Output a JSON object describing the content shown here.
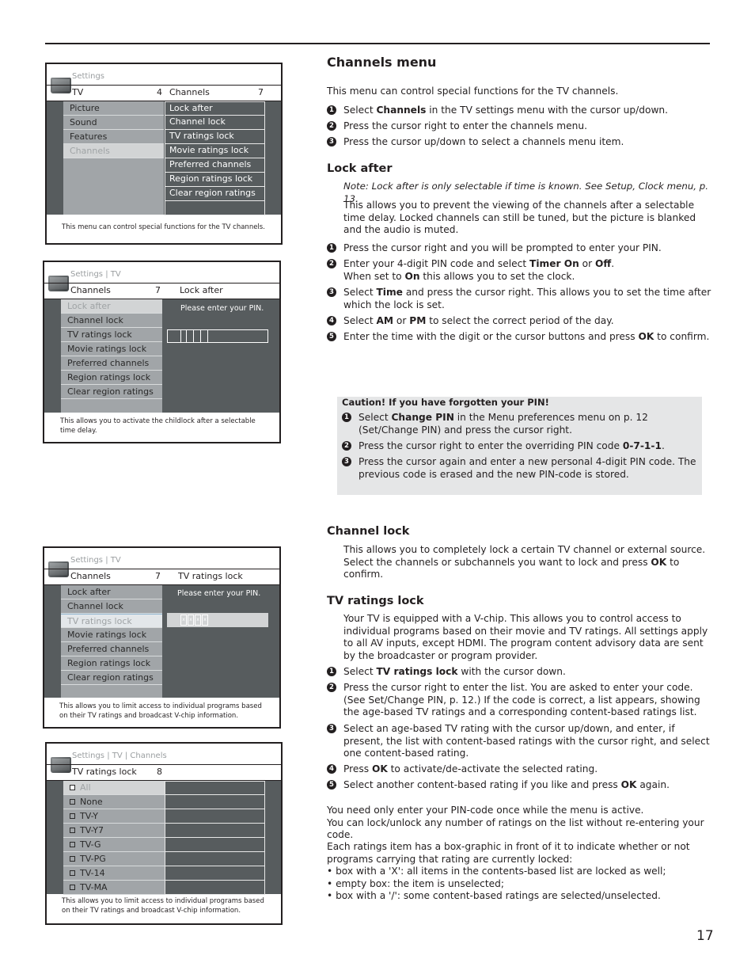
{
  "page_number": "17",
  "screens": {
    "channels_menu": {
      "breadcrumb": "Settings",
      "left_title": "TV",
      "left_count": "4",
      "right_title": "Channels",
      "right_count": "7",
      "left_items": [
        "Picture",
        "Sound",
        "Features",
        "Channels"
      ],
      "selected_left": "Channels",
      "right_items": [
        "Lock after",
        "Channel lock",
        "TV ratings lock",
        "Movie ratings lock",
        "Preferred channels",
        "Region ratings lock",
        "Clear region ratings"
      ],
      "footer": "This menu can control special functions for the TV channels."
    },
    "lock_after": {
      "breadcrumb": "Settings | TV",
      "left_title": "Channels",
      "left_count": "7",
      "right_title": "Lock after",
      "left_items": [
        "Lock after",
        "Channel lock",
        "TV ratings lock",
        "Movie ratings lock",
        "Preferred channels",
        "Region ratings lock",
        "Clear region ratings"
      ],
      "selected_left": "Lock after",
      "pin_prompt": "Please enter your PIN.",
      "footer": "This allows you to activate the childlock after a selectable time delay."
    },
    "tv_ratings_pin": {
      "breadcrumb": "Settings | TV",
      "left_title": "Channels",
      "left_count": "7",
      "right_title": "TV ratings lock",
      "left_items": [
        "Lock after",
        "Channel lock",
        "TV ratings lock",
        "Movie ratings lock",
        "Preferred channels",
        "Region ratings lock",
        "Clear region ratings"
      ],
      "selected_left": "TV ratings lock",
      "pin_prompt": "Please enter your PIN.",
      "pin_mask": [
        "x",
        "x",
        "x",
        "x"
      ],
      "footer": "This allows you to limit access to individual programs based on their TV ratings and broadcast V-chip information."
    },
    "tv_ratings_list": {
      "breadcrumb": "Settings | TV | Channels",
      "left_title": "TV ratings lock",
      "left_count": "8",
      "left_items": [
        "All",
        "None",
        "TV-Y",
        "TV-Y7",
        "TV-G",
        "TV-PG",
        "TV-14",
        "TV-MA"
      ],
      "selected_left": "All",
      "footer": "This allows you to limit access to individual programs based on their TV ratings and broadcast V-chip information."
    }
  },
  "channels_menu": {
    "title": "Channels menu",
    "intro": "This menu can control special functions for the TV channels.",
    "steps": [
      [
        "Select ",
        {
          "b": "Channels"
        },
        " in the TV settings menu with the cursor up/down."
      ],
      [
        "Press the cursor right to enter the channels menu."
      ],
      [
        "Press the cursor up/down to select a channels menu item."
      ]
    ]
  },
  "lock_after": {
    "title": "Lock after",
    "note": "Note: Lock after is only selectable if time is known. See Setup, Clock menu, p. 13.",
    "desc": "This allows you to prevent the viewing of the channels after a selectable time delay. Locked channels can still be tuned, but the picture is blanked and the audio is muted.",
    "steps": [
      [
        "Press the cursor right and you will be prompted to enter your PIN."
      ],
      [
        "Enter your 4-digit PIN code and select ",
        {
          "b": "Timer On"
        },
        " or ",
        {
          "b": "Off"
        },
        ".",
        {
          "br": true
        },
        "When set to ",
        {
          "b": "On"
        },
        " this allows you to set the clock."
      ],
      [
        "Select ",
        {
          "b": "Time"
        },
        " and press the cursor right. This allows you to set the time after which the lock is set."
      ],
      [
        "Select ",
        {
          "b": "AM"
        },
        " or ",
        {
          "b": "PM"
        },
        " to select the correct period of the day."
      ],
      [
        "Enter the time with the digit or the cursor buttons and press ",
        {
          "b": "OK"
        },
        " to confirm."
      ]
    ]
  },
  "caution": {
    "title": "Caution! If you have forgotten your PIN!",
    "steps": [
      [
        "Select ",
        {
          "b": "Change PIN"
        },
        " in the Menu preferences menu on p. 12 (Set/Change PIN) and press the cursor right."
      ],
      [
        "Press the cursor right to enter the overriding PIN code ",
        {
          "b": "0-7-1-1"
        },
        "."
      ],
      [
        "Press the cursor again and enter a new personal 4-digit PIN code. The previous code is erased and the new PIN-code is stored."
      ]
    ]
  },
  "channel_lock": {
    "title": "Channel lock",
    "desc": [
      "This allows you to completely lock a certain TV channel or external source.",
      {
        "br": true
      },
      "Select the channels or subchannels you want to lock and press ",
      {
        "b": "OK"
      },
      " to confirm."
    ]
  },
  "tv_ratings_lock": {
    "title": "TV ratings lock",
    "desc": "Your TV is equipped with a V-chip. This allows you to control access to individual programs based on their movie and TV ratings. All settings apply to all AV inputs, except HDMI. The program content advisory data are sent by the broadcaster or program provider.",
    "steps": [
      [
        "Select ",
        {
          "b": "TV ratings lock"
        },
        " with the cursor down."
      ],
      [
        "Press the cursor right to enter the list. You are asked to enter your code. (See Set/Change PIN, p. 12.) If the code is correct, a list appears, showing the age-based TV ratings and a corresponding content-based ratings list."
      ],
      [
        "Select an age-based TV rating with the cursor up/down, and enter, if present, the list with content-based ratings with the cursor right, and select one content-based rating."
      ],
      [
        "Press ",
        {
          "b": "OK"
        },
        " to activate/de-activate the selected rating."
      ],
      [
        "Select another content-based rating if you like and press ",
        {
          "b": "OK"
        },
        " again."
      ]
    ],
    "para1": [
      "You need only enter your PIN-code once while the menu is active.",
      "You can lock/unlock any number of ratings on the list without re-entering your code."
    ],
    "para2": [
      "Each ratings item has a box-graphic in front of it to indicate whether or not programs carrying that rating are currently locked:"
    ],
    "bullets": [
      "box with a 'X': all items in the contents-based list are locked as well;",
      "empty box: the item is unselected;",
      "box with a '/': some content-based ratings are selected/unselected."
    ]
  }
}
